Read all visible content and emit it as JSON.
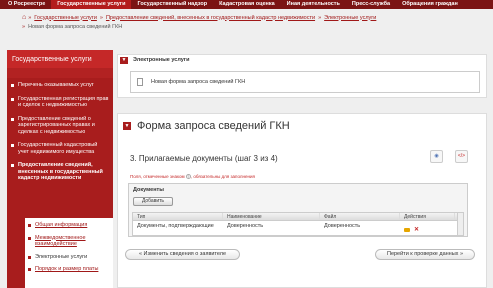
{
  "topnav": [
    "О Росреестре",
    "Государственные услуги",
    "Государственный надзор",
    "Кадастровая оценка",
    "Иная деятельность",
    "Пресс-служба",
    "Обращения граждан"
  ],
  "breadcrumb": {
    "links": [
      "Государственные услуги",
      "Предоставление сведений, внесенных в государственный кадастр недвижимости",
      "Электронные услуги"
    ],
    "current": "Новая форма запроса сведений ГКН"
  },
  "sidebar": {
    "title": "Государственные услуги",
    "items": [
      "Перечень оказываемых услуг",
      "Государственная регистрация прав и сделок с недвижимостью",
      "Предоставление сведений о зарегистрированных правах и сделках с недвижимостью",
      "Государственный кадастровый учет недвижимого имущества"
    ],
    "active": "Предоставление сведений, внесенных в государственный кадастр недвижимости",
    "sub_items": [
      "Общая информация",
      "Межведомственное взаимодействие",
      "Электронные услуги",
      "Порядок и размер платы"
    ]
  },
  "eservices": {
    "heading": "Электронные услуги",
    "link": "Новая форма запроса сведений ГКН"
  },
  "form": {
    "title": "Форма запроса сведений ГКН",
    "step": "3. Прилагаемые документы (шаг 3 из 4)",
    "required_note": "Поля, отмеченные знаком",
    "required_note2": ", обязательны для заполнения",
    "docs_label": "Документы",
    "add_button": "Добавить",
    "columns": [
      "Тип",
      "Наименование",
      "Файл",
      "Действия"
    ],
    "rows": [
      {
        "type": "Документы, подтверждающие",
        "name": "Доверенность",
        "file": "Доверенность"
      }
    ],
    "prev_button": "« Изменить сведения о заявителе",
    "next_button": "Перейти к проверке данных »"
  }
}
